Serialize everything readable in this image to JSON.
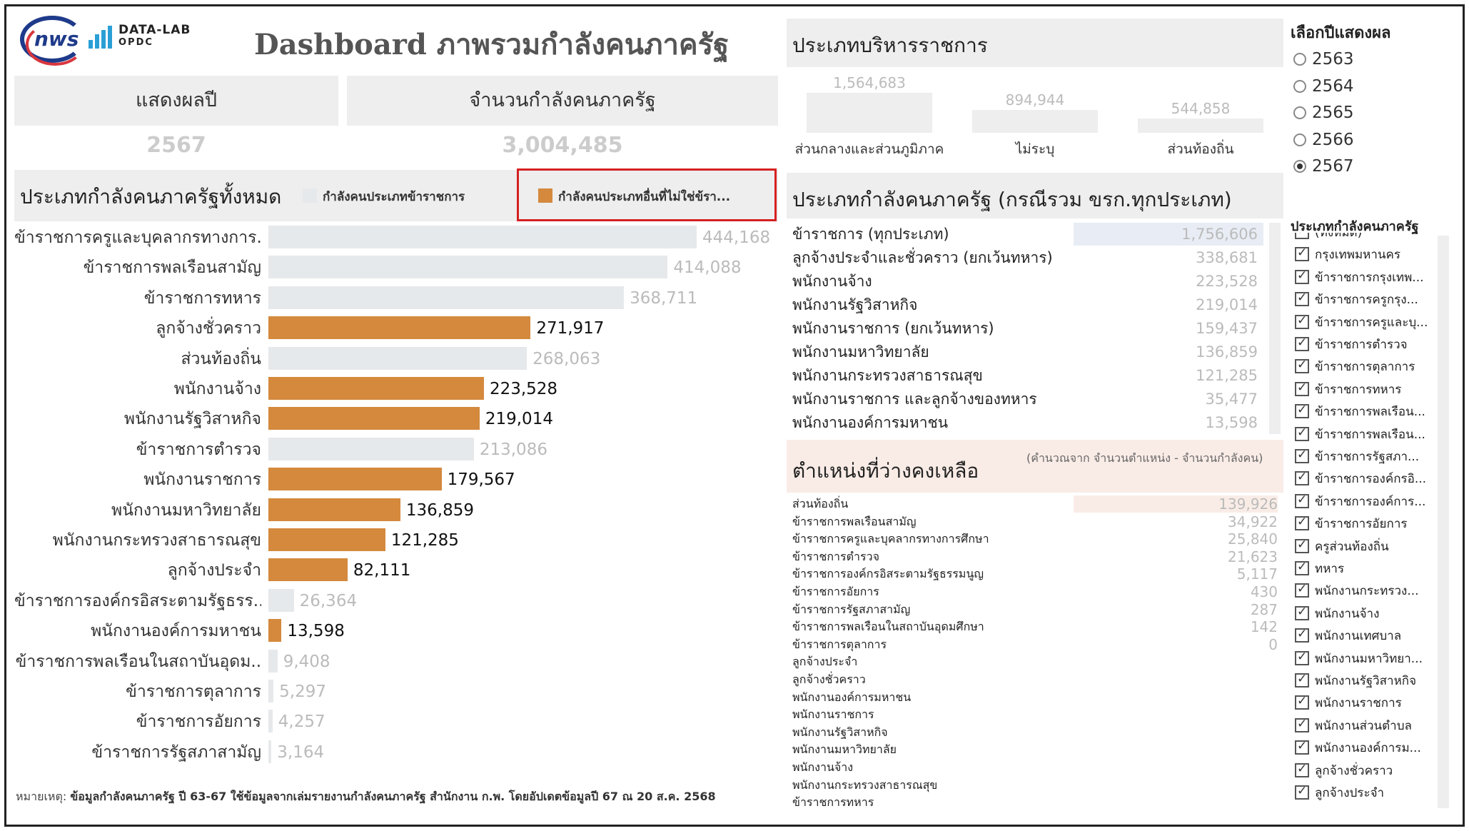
{
  "header": {
    "logo_text": "nws",
    "datalab_line1": "DATA-LAB",
    "datalab_line2": "OPDC",
    "title": "Dashboard ภาพรวมกำลังคนภาครัฐ"
  },
  "kpis": {
    "year_label": "แสดงผลปี",
    "year_value": "2567",
    "total_label": "จำนวนกำลังคนภาครัฐ",
    "total_value": "3,004,485"
  },
  "main_chart": {
    "title": "ประเภทกำลังคนภาครัฐทั้งหมด",
    "legend_civil": "กำลังคนประเภทข้าราชการ",
    "legend_other": "กำลังคนประเภทอื่นที่ไม่ใช่ข้รา...",
    "colors": {
      "civil": "#e6e9eb",
      "other": "#d4893d",
      "civil_text": "#bbbbbb",
      "other_text": "#111111"
    }
  },
  "chart_data": {
    "type": "bar",
    "orientation": "horizontal",
    "categories": [
      "ข้าราชการครูและบุคลากรทางการ..",
      "ข้าราชการพลเรือนสามัญ",
      "ข้าราชการทหาร",
      "ลูกจ้างชั่วคราว",
      "ส่วนท้องถิ่น",
      "พนักงานจ้าง",
      "พนักงานรัฐวิสาหกิจ",
      "ข้าราชการตำรวจ",
      "พนักงานราชการ",
      "พนักงานมหาวิทยาลัย",
      "พนักงานกระทรวงสาธารณสุข",
      "ลูกจ้างประจำ",
      "ข้าราชการองค์กรอิสระตามรัฐธรร..",
      "พนักงานองค์การมหาชน",
      "ข้าราชการพลเรือนในสถาบันอุดม..",
      "ข้าราชการตุลาการ",
      "ข้าราชการอัยการ",
      "ข้าราชการรัฐสภาสามัญ"
    ],
    "values": [
      444168,
      414088,
      368711,
      271917,
      268063,
      223528,
      219014,
      213086,
      179567,
      136859,
      121285,
      82111,
      26364,
      13598,
      9408,
      5297,
      4257,
      3164
    ],
    "labels": [
      "444,168",
      "414,088",
      "368,711",
      "271,917",
      "268,063",
      "223,528",
      "219,014",
      "213,086",
      "179,567",
      "136,859",
      "121,285",
      "82,111",
      "26,364",
      "13,598",
      "9,408",
      "5,297",
      "4,257",
      "3,164"
    ],
    "group": [
      "civil",
      "civil",
      "civil",
      "other",
      "civil",
      "other",
      "other",
      "civil",
      "other",
      "other",
      "other",
      "other",
      "civil",
      "other",
      "civil",
      "civil",
      "civil",
      "civil"
    ],
    "xlim": [
      0,
      444168
    ]
  },
  "admin_chart": {
    "title": "ประเภทบริหารราชการ",
    "items": [
      {
        "label": "ส่วนกลางและส่วนภูมิภาค",
        "value": 1564683,
        "text": "1,564,683"
      },
      {
        "label": "ไม่ระบุ",
        "value": 894944,
        "text": "894,944"
      },
      {
        "label": "ส่วนท้องถิ่น",
        "value": 544858,
        "text": "544,858"
      }
    ]
  },
  "type_table": {
    "title": "ประเภทกำลังคนภาครัฐ (กรณีรวม ขรก.ทุกประเภท)",
    "rows": [
      {
        "label": "ข้าราชการ (ทุกประเภท)",
        "value": "1,756,606"
      },
      {
        "label": "ลูกจ้างประจำและชั่วคราว (ยกเว้นทหาร)",
        "value": "338,681"
      },
      {
        "label": "พนักงานจ้าง",
        "value": "223,528"
      },
      {
        "label": "พนักงานรัฐวิสาหกิจ",
        "value": "219,014"
      },
      {
        "label": "พนักงานราชการ (ยกเว้นทหาร)",
        "value": "159,437"
      },
      {
        "label": "พนักงานมหาวิทยาลัย",
        "value": "136,859"
      },
      {
        "label": "พนักงานกระทรวงสาธารณสุข",
        "value": "121,285"
      },
      {
        "label": "พนักงานราชการ และลูกจ้างของทหาร",
        "value": "35,477"
      },
      {
        "label": "พนักงานองค์การมหาชน",
        "value": "13,598"
      }
    ]
  },
  "vacancy": {
    "title": "ตำแหน่งที่ว่างคงเหลือ",
    "note": "(คำนวณจาก จำนวนตำแหน่ง - จำนวนกำลังคน)",
    "rows": [
      {
        "label": "ส่วนท้องถิ่น",
        "value": "139,926"
      },
      {
        "label": "ข้าราชการพลเรือนสามัญ",
        "value": "34,922"
      },
      {
        "label": "ข้าราชการครูและบุคลากรทางการศึกษา",
        "value": "25,840"
      },
      {
        "label": "ข้าราชการตำรวจ",
        "value": "21,623"
      },
      {
        "label": "ข้าราชการองค์กรอิสระตามรัฐธรรมนูญ",
        "value": "5,117"
      },
      {
        "label": "ข้าราชการอัยการ",
        "value": "430"
      },
      {
        "label": "ข้าราชการรัฐสภาสามัญ",
        "value": "287"
      },
      {
        "label": "ข้าราชการพลเรือนในสถาบันอุดมศึกษา",
        "value": "142"
      },
      {
        "label": "ข้าราชการตุลาการ",
        "value": "0"
      },
      {
        "label": "ลูกจ้างประจำ",
        "value": ""
      },
      {
        "label": "ลูกจ้างชั่วคราว",
        "value": ""
      },
      {
        "label": "พนักงานองค์การมหาชน",
        "value": ""
      },
      {
        "label": "พนักงานราชการ",
        "value": ""
      },
      {
        "label": "พนักงานรัฐวิสาหกิจ",
        "value": ""
      },
      {
        "label": "พนักงานมหาวิทยาลัย",
        "value": ""
      },
      {
        "label": "พนักงานจ้าง",
        "value": ""
      },
      {
        "label": "พนักงานกระทรวงสาธารณสุข",
        "value": ""
      },
      {
        "label": "ข้าราชการทหาร",
        "value": ""
      }
    ]
  },
  "year_filter": {
    "title": "เลือกปีแสดงผล",
    "options": [
      "2563",
      "2564",
      "2565",
      "2566",
      "2567"
    ],
    "selected": "2567"
  },
  "type_filter": {
    "title": "ประเภทกำลังคนภาครัฐ",
    "items": [
      "(ทั้งหมด)",
      "กรุงเทพมหานคร",
      "ข้าราชการกรุงเทพ...",
      "ข้าราชการครูกรุง...",
      "ข้าราชการครูและบุ...",
      "ข้าราชการตำรวจ",
      "ข้าราชการตุลาการ",
      "ข้าราชการทหาร",
      "ข้าราชการพลเรือน...",
      "ข้าราชการพลเรือน...",
      "ข้าราชการรัฐสภา...",
      "ข้าราชการองค์กรอิ...",
      "ข้าราชการองค์การ...",
      "ข้าราชการอัยการ",
      "ครูส่วนท้องถิ่น",
      "ทหาร",
      "พนักงานกระทรวง...",
      "พนักงานจ้าง",
      "พนักงานเทศบาล",
      "พนักงานมหาวิทยา...",
      "พนักงานรัฐวิสาหกิจ",
      "พนักงานราชการ",
      "พนักงานส่วนตำบล",
      "พนักงานองค์การม...",
      "ลูกจ้างชั่วคราว",
      "ลูกจ้างประจำ"
    ]
  },
  "footnote": {
    "prefix": "หมายเหตุ:",
    "text": "ข้อมูลกำลังคนภาครัฐ ปี 63-67 ใช้ข้อมูลจากเล่มรายงานกำลังคนภาครัฐ สำนักงาน ก.พ. โดยอัปเดตข้อมูลปี 67 ณ 20 ส.ค. 2568"
  }
}
